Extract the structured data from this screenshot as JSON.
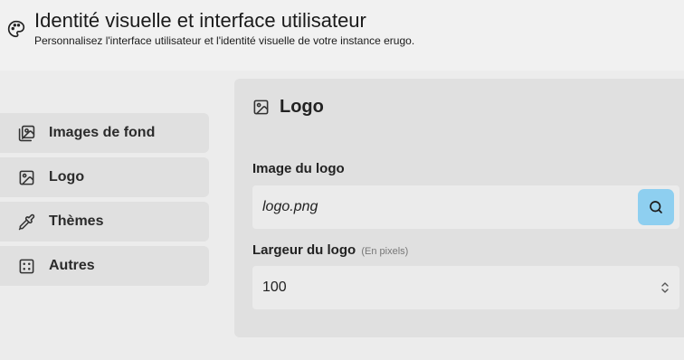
{
  "header": {
    "title": "Identité visuelle et interface utilisateur",
    "subtitle": "Personnalisez l'interface utilisateur et l'identité visuelle de votre instance erugo."
  },
  "sidebar": {
    "items": [
      {
        "label": "Images de fond",
        "icon": "images-icon"
      },
      {
        "label": "Logo",
        "icon": "image-icon"
      },
      {
        "label": "Thèmes",
        "icon": "pipette-icon"
      },
      {
        "label": "Autres",
        "icon": "dice-icon"
      }
    ]
  },
  "panel": {
    "title": "Logo",
    "logo_image": {
      "label": "Image du logo",
      "value": "logo.png"
    },
    "logo_width": {
      "label": "Largeur du logo",
      "hint": "(En pixels)",
      "value": "100"
    }
  },
  "colors": {
    "accent": "#8ecff0",
    "panel_bg": "#e0e0e0",
    "field_bg": "#ebebeb"
  }
}
